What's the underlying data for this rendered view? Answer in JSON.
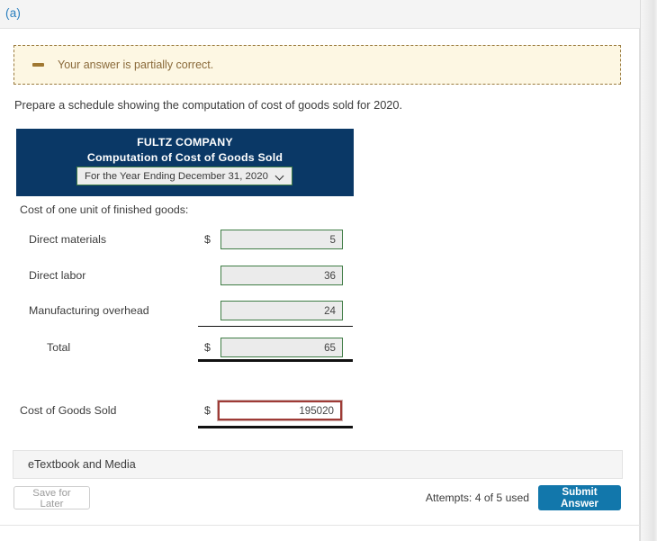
{
  "part": {
    "label": "(a)"
  },
  "alert": {
    "icon": "minus-icon",
    "message": "Your answer is partially correct."
  },
  "instruction": "Prepare a schedule showing the computation of cost of goods sold for 2020.",
  "statement": {
    "company": "FULTZ COMPANY",
    "title": "Computation of Cost of Goods Sold",
    "period_selected": "For the Year Ending December 31, 2020",
    "period_options": [
      "For the Year Ending December 31, 2020"
    ],
    "section_heading": "Cost of one unit of finished goods:",
    "rows": [
      {
        "label": "Direct materials",
        "currency": "$",
        "value": "5"
      },
      {
        "label": "Direct labor",
        "currency": "",
        "value": "36"
      },
      {
        "label": "Manufacturing overhead",
        "currency": "",
        "value": "24"
      },
      {
        "label": "Total",
        "currency": "$",
        "value": "65"
      }
    ],
    "cogs": {
      "label": "Cost of Goods Sold",
      "currency": "$",
      "value": "195020"
    }
  },
  "etextbook": {
    "label": "eTextbook and Media"
  },
  "footer": {
    "save_label": "Save for Later",
    "attempts": "Attempts: 4 of 5 used",
    "submit_label": "Submit Answer"
  },
  "colors": {
    "statement_header": "#0a3866",
    "submit_button": "#1277ab",
    "part_label": "#2a7fbf",
    "alert_bg": "#fdf7e3",
    "alert_border": "#9a7b3e",
    "input_border": "#3f7c45",
    "error_border": "#9e3b36"
  }
}
